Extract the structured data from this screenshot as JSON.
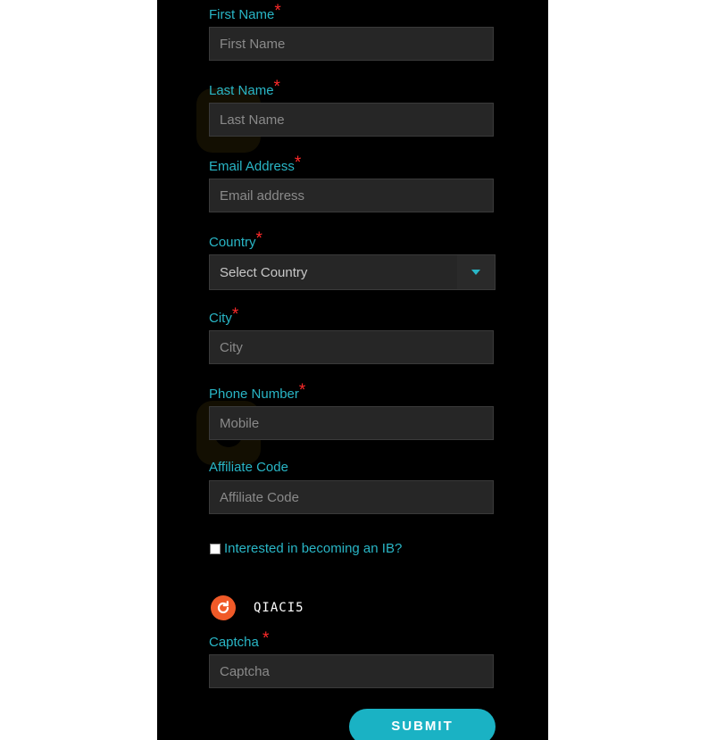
{
  "form": {
    "first_name": {
      "label": "First Name",
      "placeholder": "First Name",
      "required": "*"
    },
    "last_name": {
      "label": "Last Name",
      "placeholder": "Last Name",
      "required": "*"
    },
    "email": {
      "label": "Email Address",
      "placeholder": "Email address",
      "required": "*"
    },
    "country": {
      "label": "Country",
      "selected": "Select Country",
      "required": "*"
    },
    "city": {
      "label": "City",
      "placeholder": "City",
      "required": "*"
    },
    "phone": {
      "label": "Phone Number",
      "placeholder": "Mobile",
      "required": "*"
    },
    "affiliate": {
      "label": "Affiliate Code",
      "placeholder": "Affiliate Code"
    },
    "ib_checkbox": {
      "label": "Interested in becoming an IB?",
      "checked": false
    },
    "captcha": {
      "code": "QIACI5",
      "label": "Captcha",
      "required": "*",
      "placeholder": "Captcha"
    },
    "submit": {
      "label": "SUBMIT"
    }
  },
  "colors": {
    "accent": "#29b6c6",
    "required": "#ff2a2a",
    "panel_bg": "#000000",
    "input_bg": "#262626",
    "refresh": "#f05a28",
    "button": "#1ab2c4"
  },
  "icons": {
    "refresh": "refresh-icon",
    "dropdown": "caret-down-icon"
  }
}
